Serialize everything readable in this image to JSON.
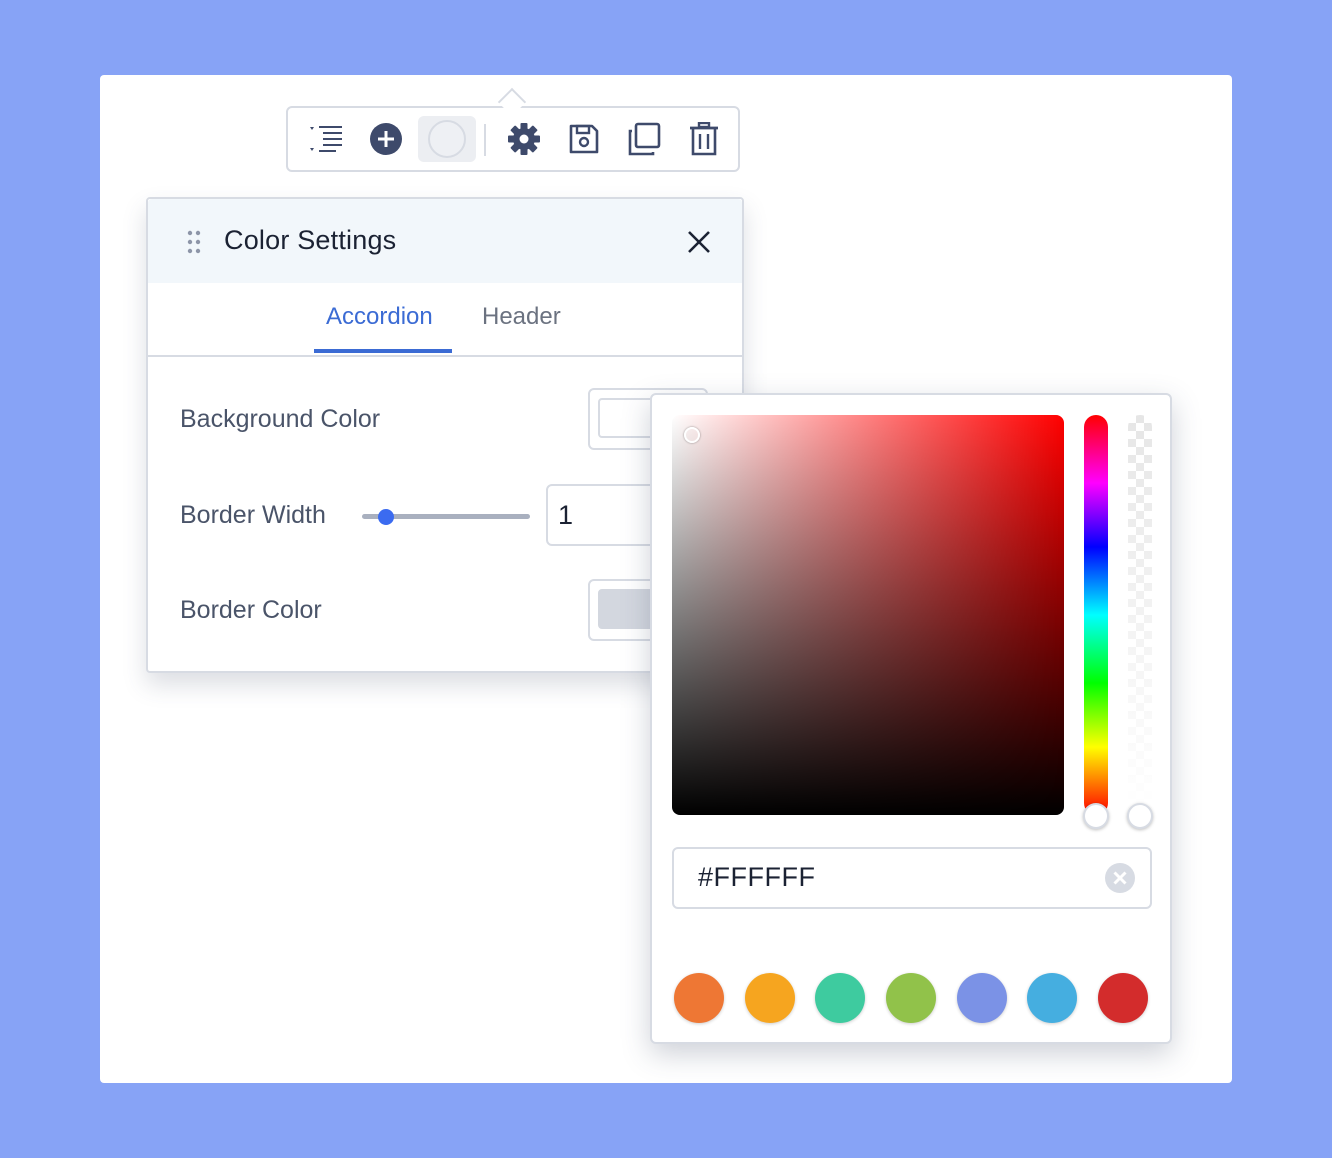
{
  "panel": {
    "title": "Color Settings",
    "tabs": [
      {
        "label": "Accordion",
        "active": true
      },
      {
        "label": "Header",
        "active": false
      }
    ],
    "rows": {
      "background_color_label": "Background Color",
      "border_width_label": "Border Width",
      "border_width_value": "1",
      "border_color_label": "Border Color"
    },
    "background_color": "#ffffff",
    "border_color": "#d3d7df"
  },
  "picker": {
    "hex_value": "#FFFFFF",
    "presets": [
      "#ee7734",
      "#f6a51f",
      "#3ecb9f",
      "#91c24a",
      "#7b92e6",
      "#45aee0",
      "#d32c2c"
    ]
  },
  "toolbar": {
    "icons": [
      "list-indent-icon",
      "add-circle-icon",
      "color-circle-icon",
      "gear-icon",
      "save-icon",
      "duplicate-icon",
      "trash-icon"
    ]
  },
  "colors": {
    "accent": "#3b6bd4",
    "background": "#87a3f6",
    "icon": "#3e4a6b"
  }
}
